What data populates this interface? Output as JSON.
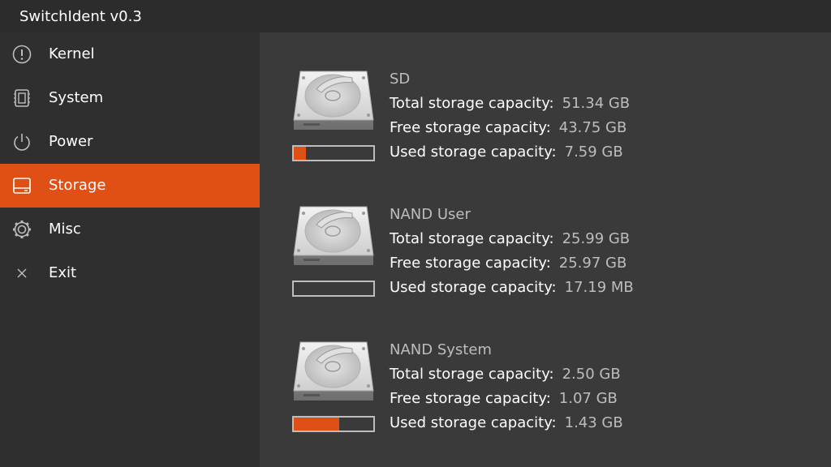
{
  "app": {
    "title": "SwitchIdent v0.3"
  },
  "sidebar": {
    "items": [
      {
        "label": "Kernel",
        "icon": "alert-circle-icon",
        "active": false
      },
      {
        "label": "System",
        "icon": "chip-icon",
        "active": false
      },
      {
        "label": "Power",
        "icon": "power-icon",
        "active": false
      },
      {
        "label": "Storage",
        "icon": "storage-icon",
        "active": true
      },
      {
        "label": "Misc",
        "icon": "gear-icon",
        "active": false
      },
      {
        "label": "Exit",
        "icon": "close-icon",
        "active": false
      }
    ]
  },
  "storage": {
    "accent_color": "#e04f15",
    "drives": [
      {
        "name": "SD",
        "total_label": "Total storage capacity:",
        "total_value": "51.34 GB",
        "free_label": "Free storage capacity:",
        "free_value": "43.75 GB",
        "used_label": "Used storage capacity:",
        "used_value": "7.59 GB",
        "used_fraction": 0.15
      },
      {
        "name": "NAND User",
        "total_label": "Total storage capacity:",
        "total_value": "25.99 GB",
        "free_label": "Free storage capacity:",
        "free_value": "25.97 GB",
        "used_label": "Used storage capacity:",
        "used_value": "17.19 MB",
        "used_fraction": 0.0
      },
      {
        "name": "NAND System",
        "total_label": "Total storage capacity:",
        "total_value": "2.50 GB",
        "free_label": "Free storage capacity:",
        "free_value": "1.07 GB",
        "used_label": "Used storage capacity:",
        "used_value": "1.43 GB",
        "used_fraction": 0.57
      }
    ]
  }
}
